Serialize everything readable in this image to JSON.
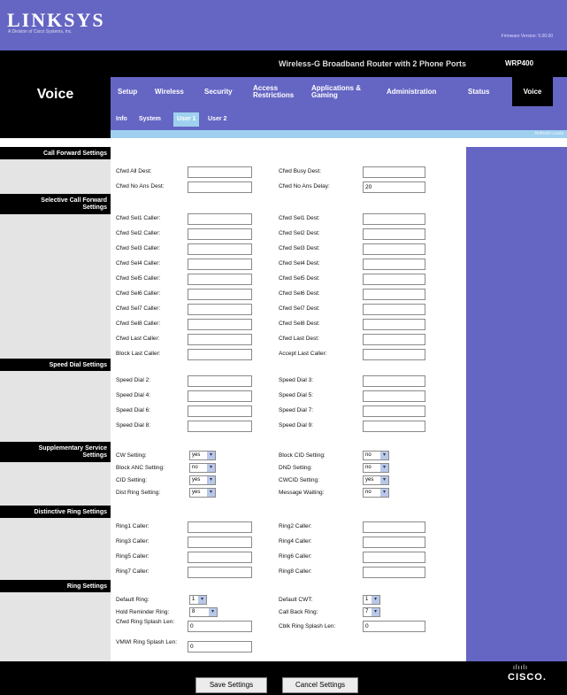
{
  "brand": {
    "name": "LINKSYS",
    "tagline": "A Division of Cisco Systems, Inc.",
    "firmware": "Firmware Version: 5.00.00"
  },
  "page": {
    "name": "Voice"
  },
  "product": {
    "title": "Wireless-G Broadband Router with 2 Phone Ports",
    "model": "WRP400"
  },
  "main_tabs": [
    "Setup",
    "Wireless",
    "Security",
    "Access Restrictions",
    "Applications & Gaming",
    "Administration",
    "Status",
    "Voice"
  ],
  "sub_tabs": [
    "Info",
    "System",
    "User 1",
    "User 2"
  ],
  "help_link": "Refresh Loads",
  "sections": {
    "call_forward": "Call Forward Settings",
    "selective_call_forward": "Selective Call Forward Settings",
    "speed_dial": "Speed Dial Settings",
    "supplementary": "Supplementary Service Settings",
    "distinctive_ring": "Distinctive Ring Settings",
    "ring": "Ring Settings"
  },
  "call_forward": [
    {
      "left": "Cfwd All Dest:",
      "right": "Cfwd Busy Dest:",
      "right_value": ""
    },
    {
      "left": "Cfwd No Ans Dest:",
      "right": "Cfwd No Ans Delay:",
      "right_value": "20"
    }
  ],
  "selective_call_forward": [
    {
      "left": "Cfwd Sel1 Caller:",
      "right": "Cfwd Sel1 Dest:"
    },
    {
      "left": "Cfwd Sel2 Caller:",
      "right": "Cfwd Sel2 Dest:"
    },
    {
      "left": "Cfwd Sel3 Caller:",
      "right": "Cfwd Sel3 Dest:"
    },
    {
      "left": "Cfwd Sel4 Caller:",
      "right": "Cfwd Sel4 Dest:"
    },
    {
      "left": "Cfwd Sel5 Caller:",
      "right": "Cfwd Sel5 Dest:"
    },
    {
      "left": "Cfwd Sel6 Caller:",
      "right": "Cfwd Sel6 Dest:"
    },
    {
      "left": "Cfwd Sel7 Caller:",
      "right": "Cfwd Sel7 Dest:"
    },
    {
      "left": "Cfwd Sel8 Caller:",
      "right": "Cfwd Sel8 Dest:"
    },
    {
      "left": "Cfwd Last Caller:",
      "right": "Cfwd Last Dest:"
    },
    {
      "left": "Block Last Caller:",
      "right": "Accept Last Caller:"
    }
  ],
  "speed_dial": [
    {
      "left": "Speed Dial 2:",
      "right": "Speed Dial 3:"
    },
    {
      "left": "Speed Dial 4:",
      "right": "Speed Dial 5:"
    },
    {
      "left": "Speed Dial 6:",
      "right": "Speed Dial 7:"
    },
    {
      "left": "Speed Dial 8:",
      "right": "Speed Dial 9:"
    }
  ],
  "supplementary": [
    {
      "left": "CW Setting:",
      "left_value": "yes",
      "right": "Block CID Setting:",
      "right_value": "no"
    },
    {
      "left": "Block ANC Setting:",
      "left_value": "no",
      "right": "DND Setting:",
      "right_value": "no"
    },
    {
      "left": "CID Setting:",
      "left_value": "yes",
      "right": "CWCID Setting:",
      "right_value": "yes"
    },
    {
      "left": "Dist Ring Setting:",
      "left_value": "yes",
      "right": "Message Waiting:",
      "right_value": "no"
    }
  ],
  "distinctive_ring": [
    {
      "left": "Ring1 Caller:",
      "right": "Ring2 Caller:"
    },
    {
      "left": "Ring3 Caller:",
      "right": "Ring4 Caller:"
    },
    {
      "left": "Ring5 Caller:",
      "right": "Ring6 Caller:"
    },
    {
      "left": "Ring7 Caller:",
      "right": "Ring8 Caller:"
    }
  ],
  "ring": {
    "default_ring": {
      "label": "Default Ring:",
      "value": "1"
    },
    "default_cwt": {
      "label": "Default CWT:",
      "value": "1"
    },
    "hold_reminder": {
      "label": "Hold Reminder Ring:",
      "value": "8"
    },
    "call_back": {
      "label": "Call Back Ring:",
      "value": "7"
    },
    "cfwd_splash": {
      "label": "Cfwd Ring Splash Len:",
      "value": "0"
    },
    "cblk_splash": {
      "label": "Cblk Ring Splash Len:",
      "value": "0"
    },
    "vmwi_splash": {
      "label": "VMWI Ring Splash Len:",
      "value": "0"
    }
  },
  "buttons": {
    "save": "Save Settings",
    "cancel": "Cancel Settings"
  },
  "footer": {
    "logo": "CISCO."
  },
  "colors": {
    "purple": "#6565c4",
    "black": "#000000",
    "light_blue": "#9fd1ee",
    "gray": "#e4e4e4"
  }
}
